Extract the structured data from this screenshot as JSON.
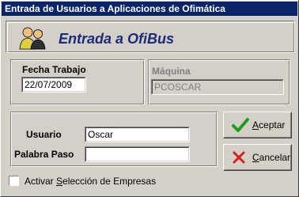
{
  "window": {
    "title": "Entrada de Usuarios a Aplicaciones de Ofimática"
  },
  "banner": {
    "title": "Entrada a OfiBus",
    "logo_icon": "two-users-icon"
  },
  "fecha": {
    "label": "Fecha Trabajo",
    "value": "22/07/2009"
  },
  "maquina": {
    "label": "Máquina",
    "value": "PCOSCAR"
  },
  "login": {
    "user_label": "Usuario",
    "user_value": "Oscar",
    "pass_label": "Palabra Paso",
    "pass_value": ""
  },
  "buttons": {
    "accept_prefix": "A",
    "accept_rest": "ceptar",
    "accept_icon": "check-icon",
    "cancel_prefix": "C",
    "cancel_rest": "ancelar",
    "cancel_icon": "x-icon"
  },
  "checkbox": {
    "pre": "Activar ",
    "ul": "S",
    "post": "elección de Empresas",
    "checked": false
  },
  "colors": {
    "titlebar": "#0a246a",
    "banner_text": "#1a2b7a",
    "accept_green": "#1e9e1e",
    "cancel_red": "#d42020"
  }
}
